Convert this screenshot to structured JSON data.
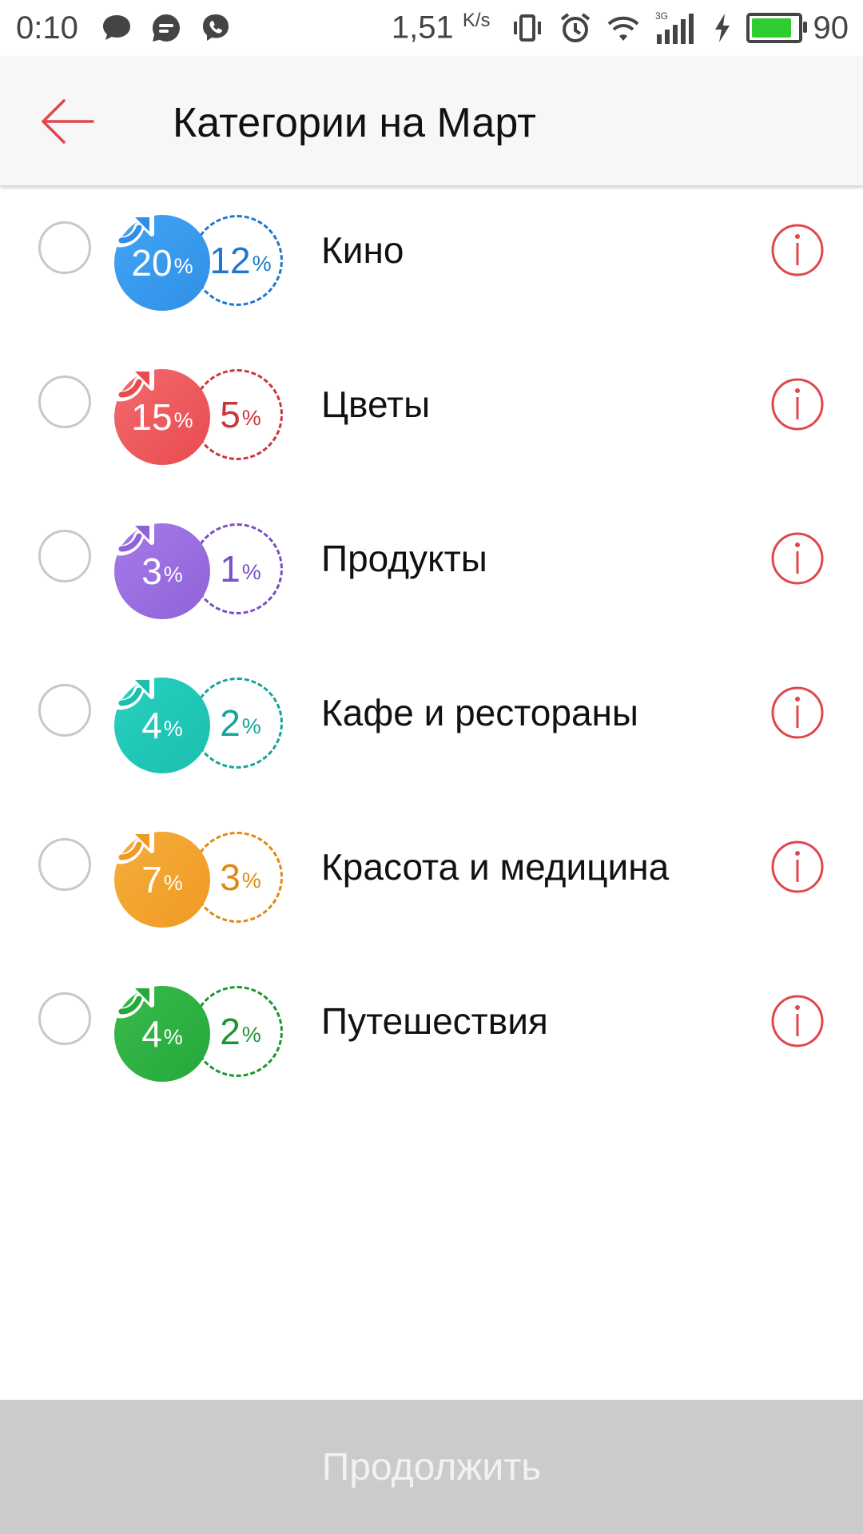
{
  "status_bar": {
    "time": "0:10",
    "speed_value": "1,51",
    "speed_unit": "K/s",
    "network_label": "3G",
    "battery_level": "90",
    "battery_color": "#2ecc2e"
  },
  "header": {
    "title": "Категории на Март",
    "back_icon": "arrow-left-icon",
    "accent_color": "#e0464b"
  },
  "categories": [
    {
      "name": "Кино",
      "main_percent": "20",
      "secondary_percent": "12",
      "color": "#2f8fe6",
      "color_light": "#42a5f5",
      "text_color": "#1e78cf"
    },
    {
      "name": "Цветы",
      "main_percent": "15",
      "secondary_percent": "5",
      "color": "#e94b4f",
      "color_light": "#f26a6d",
      "text_color": "#c9373c"
    },
    {
      "name": "Продукты",
      "main_percent": "3",
      "secondary_percent": "1",
      "color": "#8f63d8",
      "color_light": "#a57ae8",
      "text_color": "#7a4fc4"
    },
    {
      "name": "Кафе и рестораны",
      "main_percent": "4",
      "secondary_percent": "2",
      "color": "#1bbfae",
      "color_light": "#28d0bf",
      "text_color": "#17a596"
    },
    {
      "name": "Красота и медицина",
      "main_percent": "7",
      "secondary_percent": "3",
      "color": "#ef9a22",
      "color_light": "#f5ad3c",
      "text_color": "#e08912"
    },
    {
      "name": "Путешествия",
      "main_percent": "4",
      "secondary_percent": "2",
      "color": "#25a83a",
      "color_light": "#38bb4c",
      "text_color": "#1f9431"
    }
  ],
  "percent_sign": "%",
  "continue_button": {
    "label": "Продолжить"
  }
}
